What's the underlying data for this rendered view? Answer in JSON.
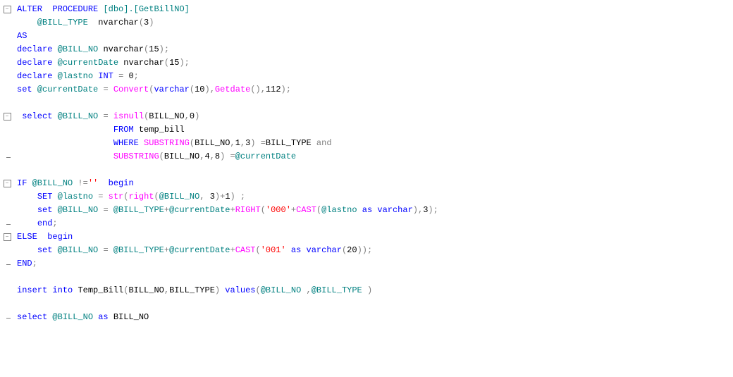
{
  "colors": {
    "keyword": "#0000FF",
    "function": "#FF00FF",
    "string": "#FF0000",
    "gray": "#808080",
    "teal": "#008080",
    "text": "#000000"
  },
  "tokens": {
    "alter": "ALTER",
    "procedure": "PROCEDURE",
    "as": "AS",
    "declare": "declare",
    "int": "INT",
    "set_l": "set",
    "set_u": "SET",
    "select": "select",
    "from": "FROM",
    "where": "WHERE",
    "and": "and",
    "if": "IF",
    "else": "ELSE",
    "begin": "begin",
    "end_s": "end",
    "end_u": "END",
    "insert": "insert",
    "into": "into",
    "values": "values",
    "as_l": "as",
    "varchar": "varchar",
    "nvarchar": "nvarchar",
    "convert": "Convert",
    "getdate": "Getdate",
    "isnull": "isnull",
    "substring": "SUBSTRING",
    "str": "str",
    "right_l": "right",
    "right_u": "RIGHT",
    "cast": "CAST"
  },
  "ids": {
    "proc": "[dbo].[GetBillNO]",
    "bill_type": "@BILL_TYPE",
    "bill_no": "@BILL_NO",
    "currentDate": "@currentDate",
    "lastno": "@lastno",
    "col_bill_no": "BILL_NO",
    "col_bill_type": "BILL_TYPE",
    "temp_bill": "temp_bill",
    "temp_bill_u": "Temp_Bill"
  },
  "lit": {
    "n3": "3",
    "n15": "15",
    "n0": "0",
    "n10": "10",
    "n112": "112",
    "n1": "1",
    "n4": "4",
    "n8": "8",
    "n20": "20",
    "empty": "''",
    "zeros": "'000'",
    "one": "'001'"
  },
  "op": {
    "eq": "=",
    "neq": "!=",
    "plus": "+",
    "semi": ";",
    "comma": ",",
    "lparen": "(",
    "rparen": ")",
    "dot": "."
  },
  "fold_symbol": "−"
}
